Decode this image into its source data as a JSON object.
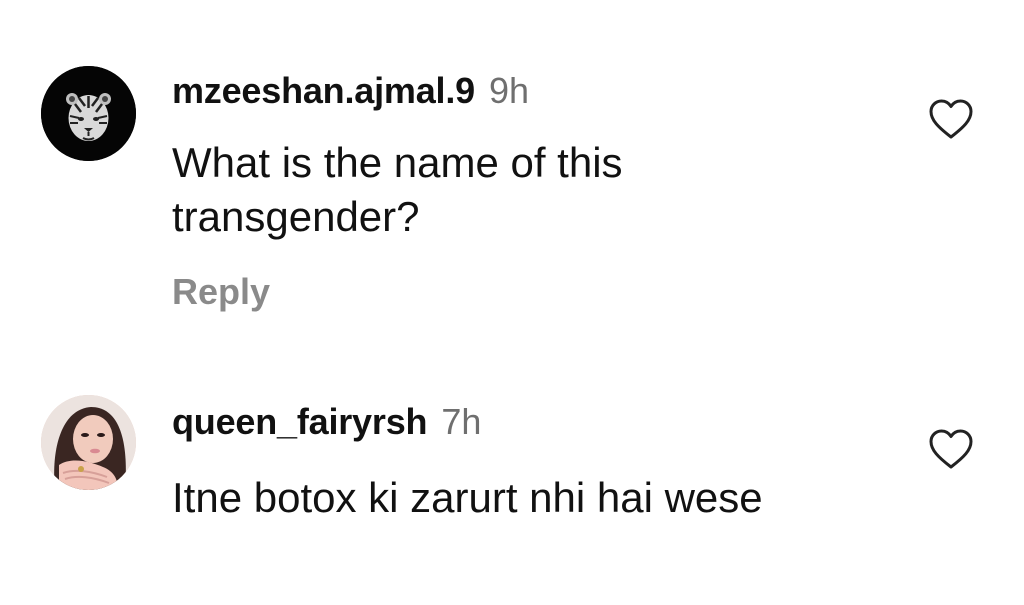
{
  "comments": [
    {
      "username": "mzeeshan.ajmal.9",
      "time": "9h",
      "text": "What is the name of this transgender?",
      "reply_label": "Reply",
      "avatar_icon": "tiger-avatar",
      "like_icon": "heart-outline-icon"
    },
    {
      "username": "queen_fairyrsh",
      "time": "7h",
      "text": "Itne botox ki zarurt nhi hai wese",
      "avatar_icon": "profile-photo-avatar",
      "like_icon": "heart-outline-icon"
    }
  ],
  "colors": {
    "text": "#111111",
    "secondary": "#6f6f6f",
    "reply": "#8a8a8a",
    "background": "#ffffff"
  }
}
